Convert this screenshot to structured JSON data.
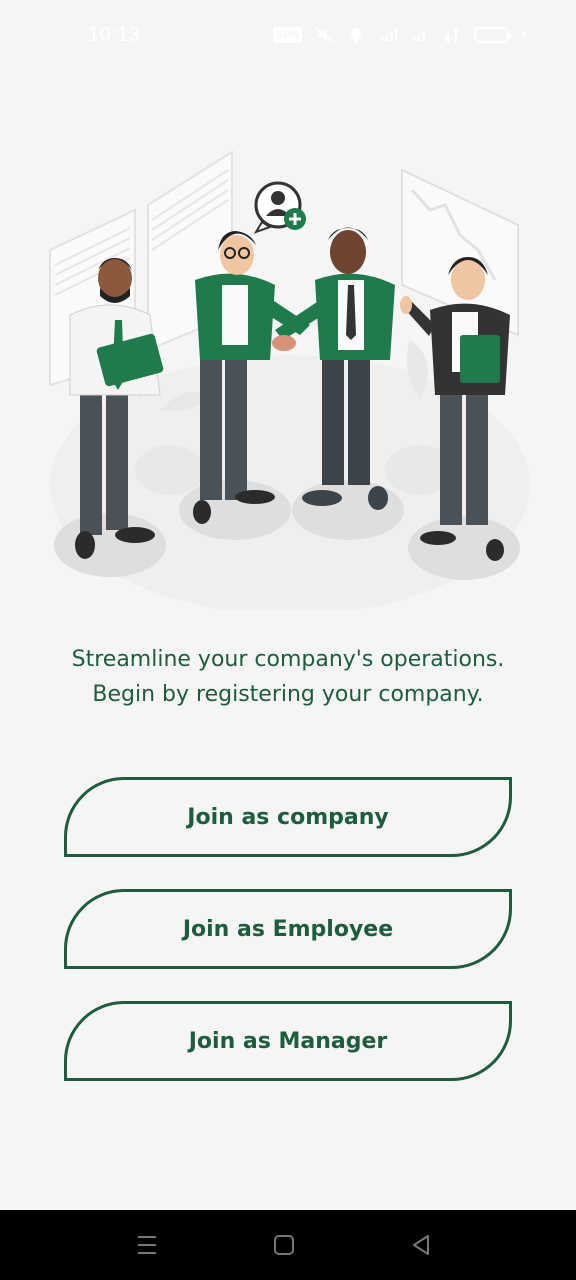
{
  "status_bar": {
    "time": "10:13",
    "vpn_label": "VPN",
    "icons": [
      "vpn-icon",
      "mute-icon",
      "location-icon",
      "signal-icon",
      "signal-icon",
      "data-icon",
      "battery-icon",
      "charging-icon"
    ]
  },
  "illustration": {
    "icon": "team-handshake-illustration",
    "accent_color": "#1f7a4c"
  },
  "tagline": {
    "line1": "Streamline your company's operations.",
    "line2": "Begin by registering your company."
  },
  "buttons": {
    "company": "Join as company",
    "employee": "Join as Employee",
    "manager": "Join as Manager"
  },
  "theme": {
    "primary": "#1e5c3e",
    "background": "#f5f5f5"
  },
  "nav_bar": {
    "icons": [
      "menu-icon",
      "home-icon",
      "back-icon"
    ]
  }
}
